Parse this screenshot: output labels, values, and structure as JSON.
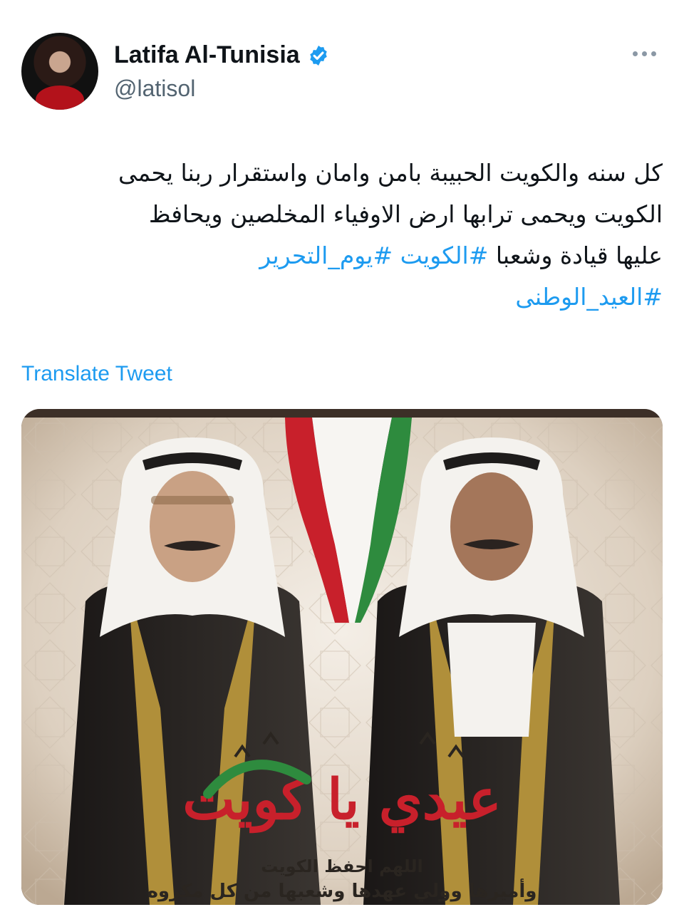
{
  "author": {
    "name": "Latifa Al-Tunisia",
    "handle": "@latisol",
    "verified": true
  },
  "tweet": {
    "lines": [
      "كل سنه والكويت الحبيبة بامن وامان واستقرار ربنا يحمى",
      "الكويت ويحمى ترابها ارض الاوفياء المخلصين ويحافظ",
      "عليها قيادة وشعبا"
    ],
    "hashtags": [
      "#الكويت",
      "#يوم_التحرير",
      "#العيد_الوطنى"
    ]
  },
  "translate_label": "Translate Tweet",
  "media": {
    "calligraphy": "عيدي يا كويت",
    "caption_line1": "اللهم احفظ الكويت",
    "caption_line2": "وأميرها وولي عهدها وشعبها من كل مكروه"
  },
  "colors": {
    "link": "#1d9bf0",
    "verified_badge": "#1d9bf0",
    "flag_green": "#2e8b3e",
    "flag_red": "#c8202b",
    "flag_black": "#141414"
  }
}
